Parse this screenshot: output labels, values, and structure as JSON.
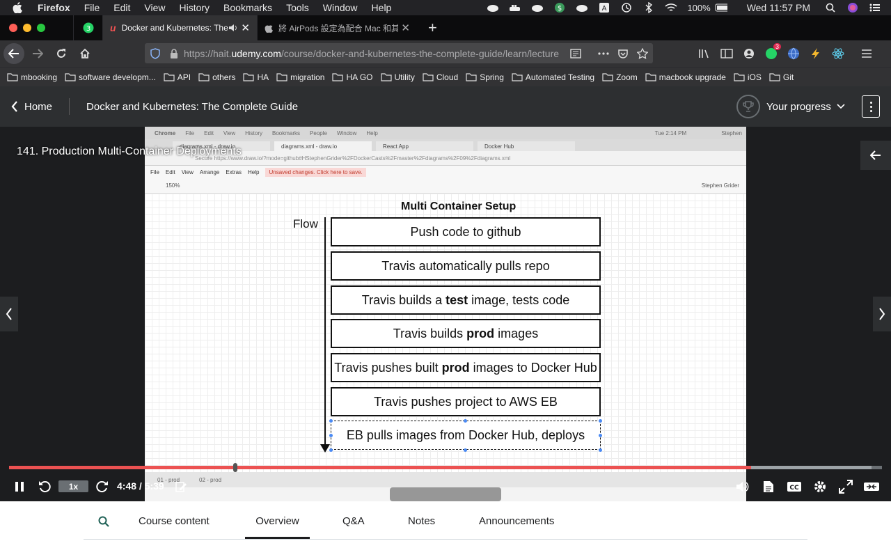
{
  "menubar": {
    "app": "Firefox",
    "items": [
      "File",
      "Edit",
      "View",
      "History",
      "Bookmarks",
      "Tools",
      "Window",
      "Help"
    ],
    "battery": "100%",
    "clock": "Wed 11:57 PM"
  },
  "tabs": {
    "pinned_badge": "3",
    "active_title": "Docker and Kubernetes: The Complete Guide",
    "other_title": "將 AirPods 設定為配合 Mac 和其他藍牙裝置使用"
  },
  "nav": {
    "url_prefix": "https://hait.",
    "url_domain": "udemy.com",
    "url_rest": "/course/docker-and-kubernetes-the-complete-guide/learn/lecture",
    "ext_badge": "3"
  },
  "bookmarks": [
    "mbooking",
    "software developm...",
    "API",
    "others",
    "HA",
    "migration",
    "HA GO",
    "Utility",
    "Cloud",
    "Spring",
    "Automated Testing",
    "Zoom",
    "macbook upgrade",
    "iOS",
    "Git"
  ],
  "header": {
    "home": "Home",
    "course_title": "Docker and Kubernetes: The Complete Guide",
    "progress": "Your progress"
  },
  "player": {
    "lecture_title": "141. Production Multi-Container Deployments",
    "rate": "1x",
    "time": "4:48 / 5:39",
    "progress_fraction": 0.85
  },
  "video_content": {
    "chrome_menu": [
      "Chrome",
      "File",
      "Edit",
      "View",
      "History",
      "Bookmarks",
      "People",
      "Window",
      "Help"
    ],
    "chrome_time": "Tue 2:14 PM",
    "chrome_user": "Stephen",
    "chrome_tabs": [
      "diagrams.xml - draw.io",
      "diagrams.xml - draw.io",
      "React App",
      "Docker Hub"
    ],
    "chrome_url": "Secure   https://www.draw.io/?mode=github#HStephenGrider%2FDockerCasts%2Fmaster%2Fdiagrams%2F09%2Fdiagrams.xml",
    "drawio_menu": [
      "File",
      "Edit",
      "View",
      "Arrange",
      "Extras",
      "Help"
    ],
    "unsaved": "Unsaved changes. Click here to save.",
    "zoom": "150%",
    "user": "Stephen Grider",
    "diagram_title": "Multi Container Setup",
    "flow_label": "Flow",
    "steps": [
      {
        "pre": "Push code to github",
        "bold": "",
        "post": ""
      },
      {
        "pre": "Travis automatically pulls repo",
        "bold": "",
        "post": ""
      },
      {
        "pre": "Travis builds a ",
        "bold": "test",
        "post": " image, tests code"
      },
      {
        "pre": "Travis builds ",
        "bold": "prod",
        "post": " images"
      },
      {
        "pre": "Travis pushes built ",
        "bold": "prod",
        "post": " images to Docker Hub"
      },
      {
        "pre": "Travis pushes project to AWS EB",
        "bold": "",
        "post": ""
      },
      {
        "pre": "EB pulls images from Docker Hub, deploys",
        "bold": "",
        "post": ""
      }
    ],
    "pages": [
      "01 - prod",
      "02 - prod"
    ]
  },
  "course_tabs": [
    "Course content",
    "Overview",
    "Q&A",
    "Notes",
    "Announcements"
  ],
  "colors": {
    "accent_red": "#ec5252",
    "header_bg": "#2d2f31",
    "player_bg": "#1c1d1f"
  }
}
